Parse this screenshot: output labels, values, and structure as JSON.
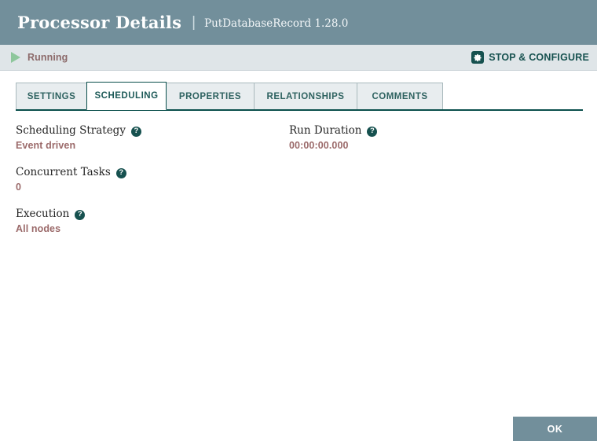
{
  "header": {
    "title": "Processor Details",
    "separator": "|",
    "subtitle": "PutDatabaseRecord 1.28.0"
  },
  "statusbar": {
    "run_status": "Running",
    "play_icon": "play-icon",
    "configure_label": "STOP & CONFIGURE",
    "gear_icon": "gear-icon"
  },
  "tabs": [
    {
      "label": "SETTINGS",
      "active": false
    },
    {
      "label": "SCHEDULING",
      "active": true
    },
    {
      "label": "PROPERTIES",
      "active": false
    },
    {
      "label": "RELATIONSHIPS",
      "active": false
    },
    {
      "label": "COMMENTS",
      "active": false
    }
  ],
  "scheduling": {
    "left_fields": [
      {
        "label": "Scheduling Strategy",
        "value": "Event driven",
        "help": "?"
      },
      {
        "label": "Concurrent Tasks",
        "value": "0",
        "help": "?"
      },
      {
        "label": "Execution",
        "value": "All nodes",
        "help": "?"
      }
    ],
    "right_fields": [
      {
        "label": "Run Duration",
        "value": "00:00:00.000",
        "help": "?"
      }
    ]
  },
  "footer": {
    "ok_label": "OK"
  },
  "colors": {
    "header_bg": "#728f9b",
    "statusbar_bg": "#dfe5e8",
    "accent_teal": "#16514f",
    "value_text": "#9b6a6a",
    "running_green": "#8ec79c",
    "button_bg": "#728f9b"
  }
}
